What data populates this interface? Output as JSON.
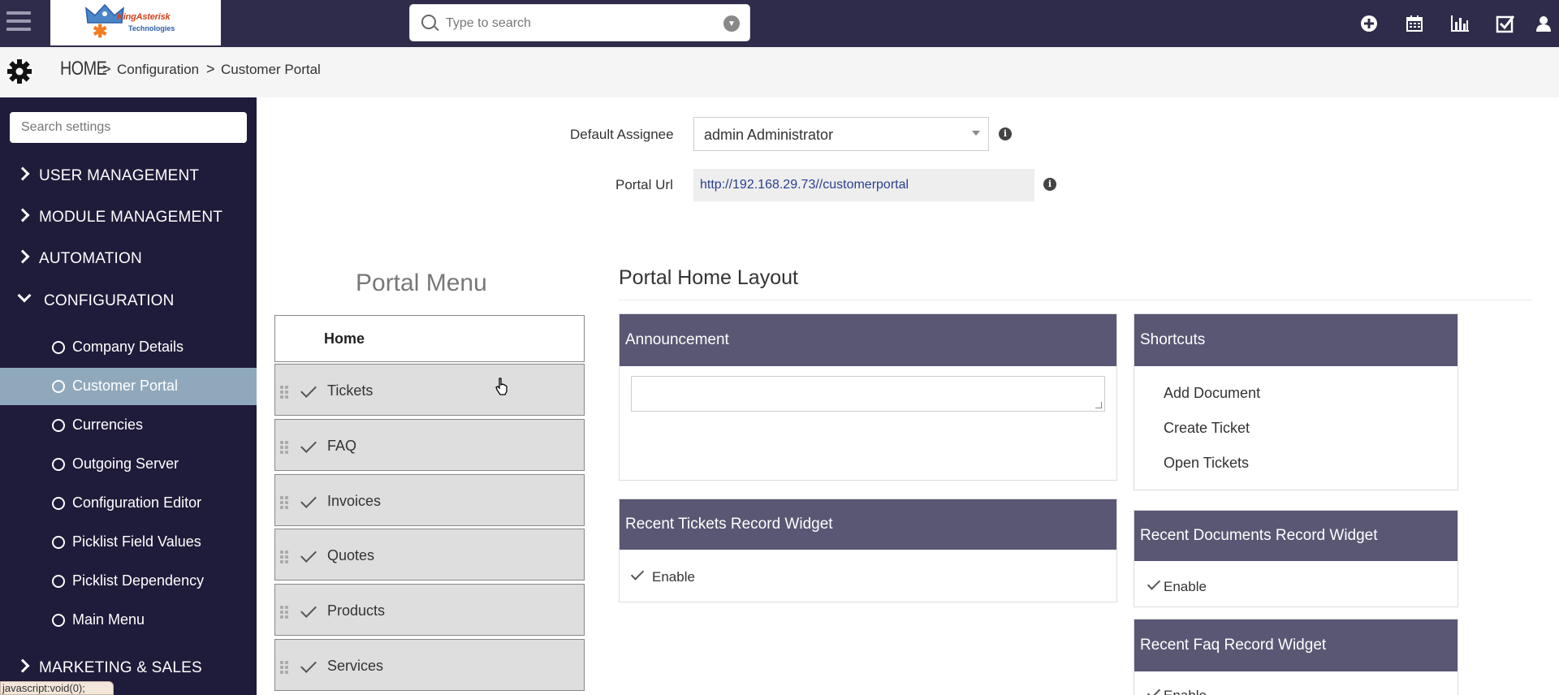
{
  "topbar": {
    "logo_text": "KingAsterisk",
    "logo_sub": "Technologies",
    "search_placeholder": "Type to search",
    "icons": [
      "plus-circle-icon",
      "calendar-icon",
      "bar-chart-icon",
      "checkbox-icon",
      "user-icon"
    ]
  },
  "breadcrumb": {
    "home": "HOME",
    "sep": ">",
    "configuration": "Configuration",
    "current": "Customer Portal"
  },
  "sidebar": {
    "search_placeholder": "Search settings",
    "sections": [
      {
        "label": "USER MANAGEMENT",
        "expanded": false
      },
      {
        "label": "MODULE MANAGEMENT",
        "expanded": false
      },
      {
        "label": "AUTOMATION",
        "expanded": false
      },
      {
        "label": "CONFIGURATION",
        "expanded": true
      },
      {
        "label": "MARKETING & SALES",
        "expanded": false
      }
    ],
    "config_items": [
      {
        "label": "Company Details"
      },
      {
        "label": "Customer Portal",
        "active": true
      },
      {
        "label": "Currencies"
      },
      {
        "label": "Outgoing Server"
      },
      {
        "label": "Configuration Editor"
      },
      {
        "label": "Picklist Field Values"
      },
      {
        "label": "Picklist Dependency"
      },
      {
        "label": "Main Menu"
      }
    ]
  },
  "status_bar": "javascript:void(0);",
  "settings": {
    "assignee_label": "Default Assignee",
    "assignee_value": "admin Administrator",
    "url_label": "Portal Url",
    "url_value": "http://192.168.29.73//customerportal"
  },
  "portal_menu": {
    "title": "Portal Menu",
    "home": "Home",
    "items": [
      "Tickets",
      "FAQ",
      "Invoices",
      "Quotes",
      "Products",
      "Services"
    ]
  },
  "portal_home_layout": {
    "title": "Portal Home Layout",
    "announcement": {
      "title": "Announcement",
      "text": ""
    },
    "shortcuts": {
      "title": "Shortcuts",
      "items": [
        "Add Document",
        "Create Ticket",
        "Open Tickets"
      ]
    },
    "widgets": [
      {
        "title": "Recent Tickets Record Widget",
        "enable_label": "Enable",
        "enabled": true
      },
      {
        "title": "Recent Documents Record Widget",
        "enable_label": "Enable",
        "enabled": true
      },
      {
        "title": "Recent Faq Record Widget",
        "enable_label": "Enable",
        "enabled": true
      }
    ]
  },
  "colors": {
    "topbar": "#2e2c4a",
    "sidebar": "#1f1b3a",
    "sidebar_active": "#8fa8bc",
    "panel_header": "#595773",
    "menu_item_bg": "#dedede",
    "url_link": "#2a3f8f"
  }
}
